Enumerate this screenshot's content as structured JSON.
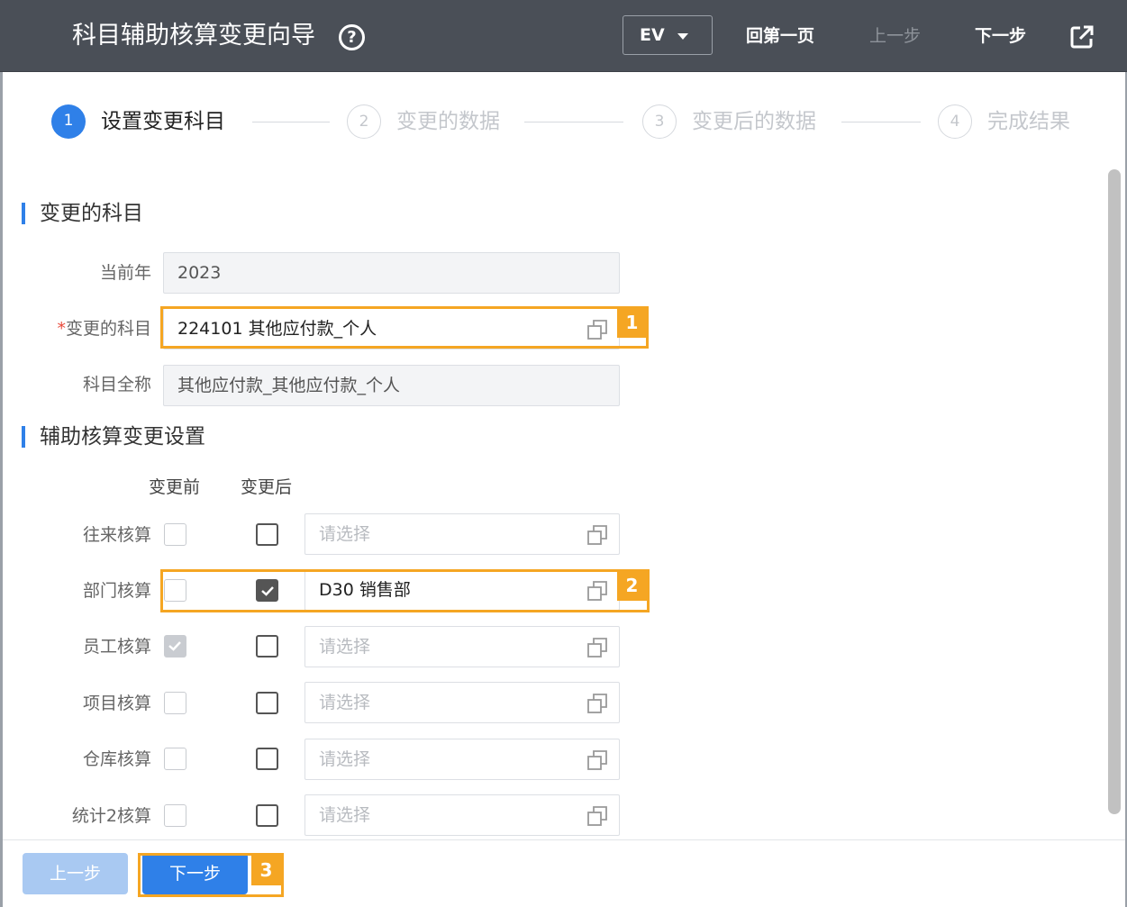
{
  "header": {
    "title": "科目辅助核算变更向导",
    "help_glyph": "?",
    "ev_label": "EV",
    "back_first": "回第一页",
    "prev": "上一步",
    "next": "下一步"
  },
  "steps": [
    {
      "num": "1",
      "label": "设置变更科目",
      "state": "active"
    },
    {
      "num": "2",
      "label": "变更的数据",
      "state": "inactive"
    },
    {
      "num": "3",
      "label": "变更后的数据",
      "state": "inactive"
    },
    {
      "num": "4",
      "label": "完成结果",
      "state": "inactive"
    }
  ],
  "section_subject": {
    "title": "变更的科目",
    "year_label": "当前年",
    "year_value": "2023",
    "required_mark": "*",
    "subject_label": "变更的科目",
    "subject_value": "224101 其他应付款_个人",
    "fullname_label": "科目全称",
    "fullname_value": "其他应付款_其他应付款_个人"
  },
  "section_aux": {
    "title": "辅助核算变更设置",
    "col_before": "变更前",
    "col_after": "变更后",
    "rows": [
      {
        "label": "往来核算",
        "before": false,
        "after": false,
        "value": "",
        "placeholder": "请选择"
      },
      {
        "label": "部门核算",
        "before": false,
        "after": true,
        "value": "D30 销售部",
        "placeholder": "请选择"
      },
      {
        "label": "员工核算",
        "before": true,
        "after": false,
        "value": "",
        "placeholder": "请选择"
      },
      {
        "label": "项目核算",
        "before": false,
        "after": false,
        "value": "",
        "placeholder": "请选择"
      },
      {
        "label": "仓库核算",
        "before": false,
        "after": false,
        "value": "",
        "placeholder": "请选择"
      },
      {
        "label": "统计2核算",
        "before": false,
        "after": false,
        "value": "",
        "placeholder": "请选择"
      }
    ]
  },
  "footer": {
    "prev": "上一步",
    "next": "下一步"
  },
  "annotations": [
    "1",
    "2",
    "3"
  ],
  "colors": {
    "header_bg": "#4a4f57",
    "accent": "#2f80e8",
    "highlight": "#f5a623"
  }
}
